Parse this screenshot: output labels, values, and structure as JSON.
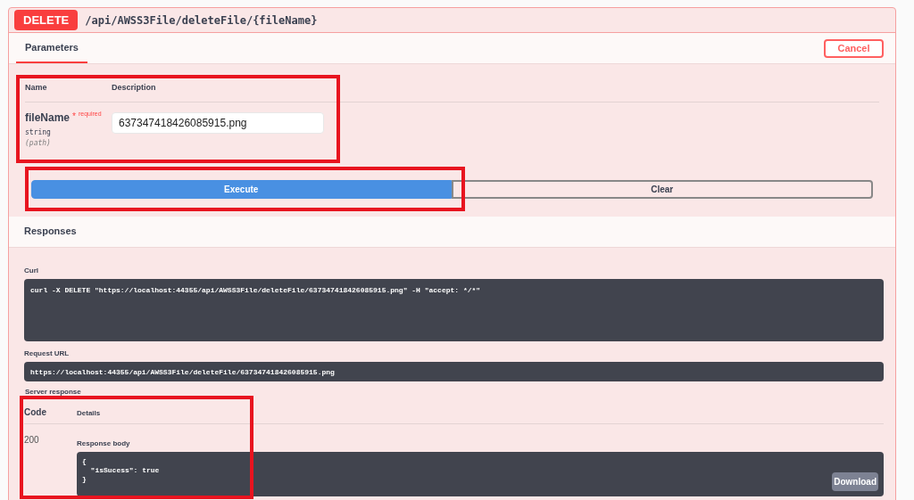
{
  "operation": {
    "method": "DELETE",
    "path": "/api/AWSS3File/deleteFile/{fileName}"
  },
  "tabs": [
    {
      "label": "Parameters",
      "selected": true
    }
  ],
  "cancel_button": "Cancel",
  "parameters": {
    "columns": [
      "Name",
      "Description"
    ],
    "rows": [
      {
        "name": "fileName",
        "required_mark": "*",
        "required": "required",
        "type": "string",
        "location": "(path)",
        "value": "637347418426085915.png"
      }
    ]
  },
  "buttons": [
    {
      "label": "Execute",
      "kind": "primary"
    },
    {
      "label": "Clear",
      "kind": "secondary"
    }
  ],
  "responses": {
    "title": "Responses",
    "curl_label": "Curl",
    "curl": "curl -X DELETE \"https://localhost:44355/api/AWSS3File/deleteFile/637347418426085915.png\" -H \"accept: */*\"",
    "request_url_label": "Request URL",
    "request_url": "https://localhost:44355/api/AWSS3File/deleteFile/637347418426085915.png",
    "server_response_label": "Server response",
    "columns": [
      "Code",
      "Details"
    ],
    "rows": [
      {
        "code": "200",
        "body_label": "Response body",
        "body": "{\n  \"isSucess\": true\n}",
        "download": "Download"
      }
    ]
  }
}
